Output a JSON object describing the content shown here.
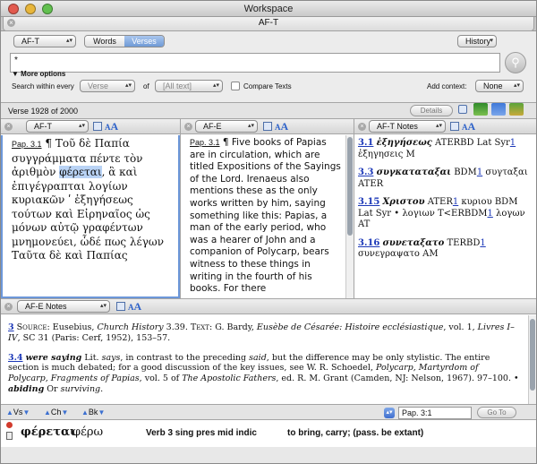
{
  "window": {
    "title": "Workspace",
    "tab": "AF-T"
  },
  "search": {
    "source": "AF-T",
    "mode_words": "Words",
    "mode_verses": "Verses",
    "history_label": "History",
    "query": "*",
    "more_options": "More options",
    "within_label": "Search within every",
    "within_value": "Verse",
    "of_label": "of",
    "of_value": "[All text]",
    "compare_label": "Compare Texts",
    "context_label": "Add context:",
    "context_value": "None"
  },
  "verse_bar": {
    "position": "Verse 1928 of 2000",
    "details_label": "Details"
  },
  "panes": [
    {
      "title": "AF-T",
      "ref": "Pap. 3.1",
      "mark": "¶",
      "text_before": "Τοῦ δὲ Παπία συγγράμματα πέντε τὸν ἀριθμὸν",
      "selected": "φέρεται",
      "text_after": ", ἃ καὶ ἐπιγέγραπται λογίων κυριακῶν ʹ ἐξηγήσεως τούτων καὶ Εἰρηναῖος ὡς μόνων αὐτῷ γραφέντων μνημονεύει, ὧδέ πως λέγων Ταῦτα δὲ καὶ Παπίας"
    },
    {
      "title": "AF-E",
      "ref": "Pap. 3.1",
      "mark": "¶",
      "text": "Five books of Papias are in circulation, which are titled Expositions of the Sayings of the Lord. Irenaeus also mentions these as the only works written by him, saying something like this: Papias, a man of the early period, who was a hearer of John and a companion of Polycarp, bears witness to these things in writing in the fourth of his books. For there"
    },
    {
      "title": "AF-T Notes",
      "notes": [
        {
          "ref": "3.1",
          "word": "ἐξηγήσεως",
          "rest1": " ATERBD Lat Syr",
          "link": "1",
          "rest2": " ἐξηγησεις M"
        },
        {
          "ref": "3.3",
          "word": "συγκαταταξαι",
          "rest1": " BDM",
          "link": "1",
          "rest2": " συγταξαι ATER"
        },
        {
          "ref": "3.15",
          "word": "Χριστου",
          "rest1": " ATER",
          "link": "1",
          "rest2": " κυριου BDM Lat Syr • λογιων T<ERBDM",
          "link2": "1",
          "rest3": " λογων AT"
        },
        {
          "ref": "3.16",
          "word": "συνεταξατο",
          "rest1": " TERBD",
          "link": "1",
          "rest2": " συνεγραψατο AM"
        }
      ]
    }
  ],
  "bottom": {
    "title": "AF-E Notes",
    "note1": {
      "num": "3",
      "src_label": "Source:",
      "src_text": " Eusebius, ",
      "src_work": "Church History",
      "src_rest": " 3.39. ",
      "text_label": "Text:",
      "text_rest": " G. Bardy, ",
      "text_work": "Eusèbe de Césarée: Histoire ecclésiastique",
      "text_tail": ", vol. 1, ",
      "text_work2": "Livres I–IV",
      "text_end": ", SC 31 (Paris: Cerf, 1952), 153–57."
    },
    "note2": {
      "num": "3.4",
      "phrase": "were saying",
      "lit": " Lit. ",
      "lit_word": "says",
      "p1": ", in contrast to the preceding ",
      "said_word": "said",
      "p2": ", but the difference may be only stylistic. The entire section is much debated; for a good discussion of the key issues, see W. R. Schoedel, ",
      "work1": "Polycarp, Martyrdom of Polycarp, Fragments of Papias",
      "p3": ", vol. 5 of ",
      "work2": "The Apostolic Fathers",
      "p4": ", ed. R. M. Grant (Camden, NJ: Nelson, 1967). 97–100. • ",
      "abiding": "abiding",
      "p5": " Or ",
      "surviving": "surviving",
      "p6": "."
    }
  },
  "nav": {
    "vs": "Vs",
    "ch": "Ch",
    "bk": "Bk",
    "goto_value": "Pap. 3:1",
    "goto_label": "Go To"
  },
  "status": {
    "word": "φέρεται",
    "lemma": "φέρω",
    "parse": "Verb 3 sing pres mid indic",
    "gloss": "to bring, carry; (pass. be extant)"
  },
  "colors": {
    "accent": "#1d39b8",
    "selection": "#b9d3f5",
    "link": "#2e62c9"
  }
}
